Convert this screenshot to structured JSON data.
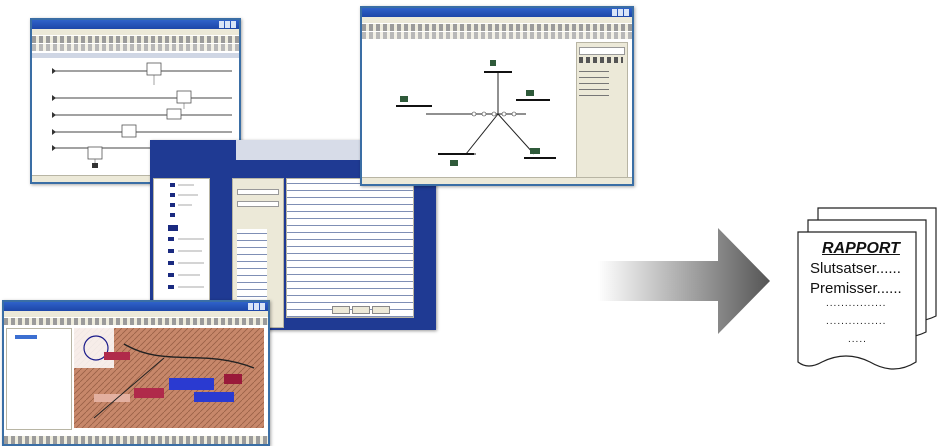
{
  "report": {
    "title": "RAPPORT",
    "lines": [
      "Slutsatser......",
      "Premisser......",
      "................",
      "................",
      "....."
    ]
  },
  "colors": {
    "window_border": "#3a6ea5",
    "titlebar": "#1d46a8",
    "dialog_frame": "#1f3a93",
    "arrow_start": "#ffffff",
    "arrow_end": "#555555"
  },
  "icons": [
    "arrow-right-icon",
    "document-stack-icon"
  ]
}
